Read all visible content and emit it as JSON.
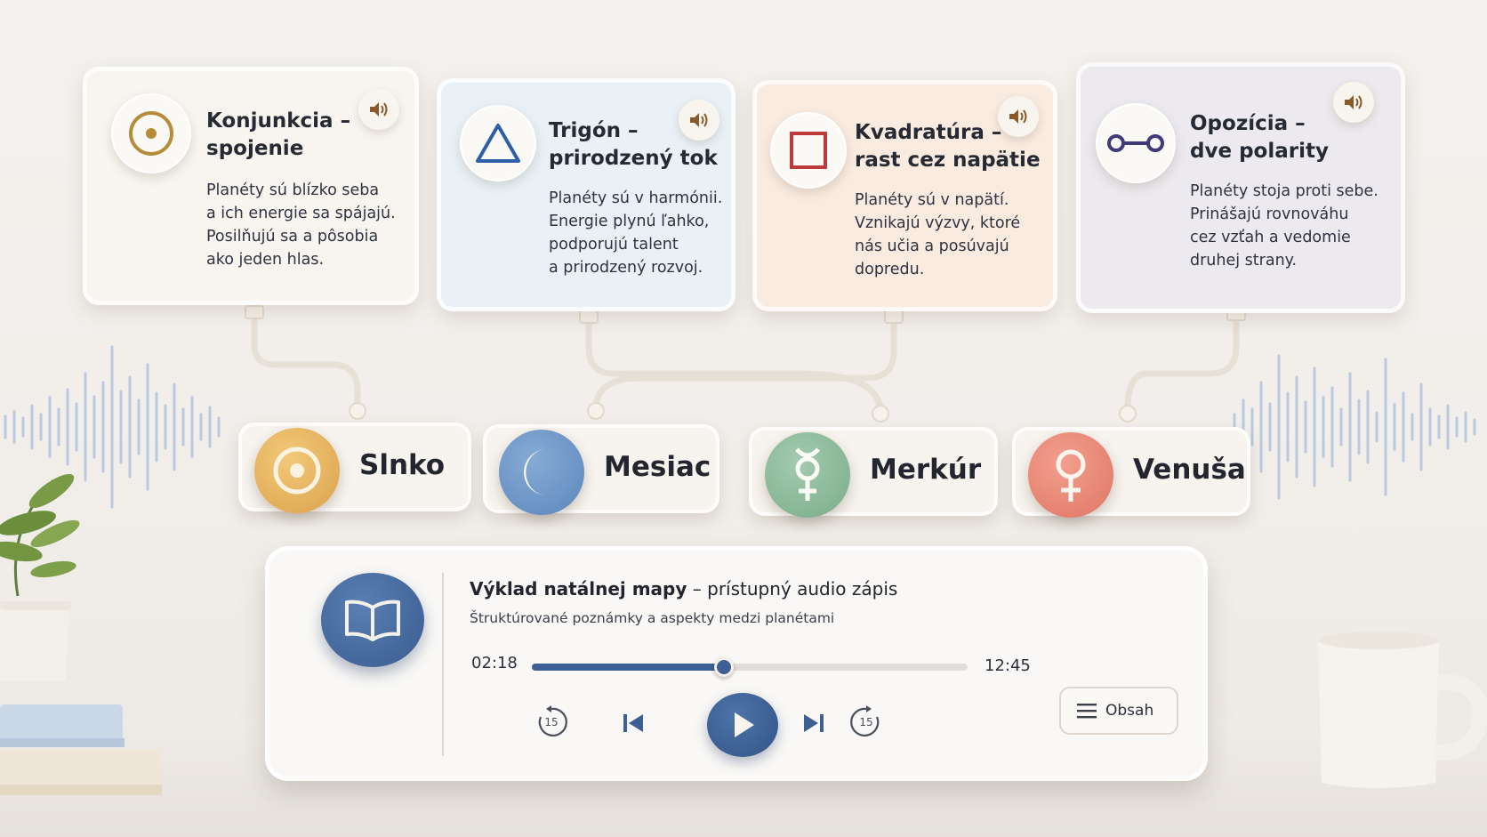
{
  "aspects": [
    {
      "title_line1": "Konjunkcia –",
      "title_line2": "spojenie",
      "desc": [
        "Planéty sú blízko seba",
        "a ich energie sa spájajú.",
        "Posilňujú sa a pôsobia",
        "ako jeden hlas."
      ],
      "icon": "conjunction-icon",
      "color": "#b58d3a"
    },
    {
      "title_line1": "Trigón –",
      "title_line2": "prirodzený tok",
      "desc": [
        "Planéty sú v harmónii.",
        "Energie plynú ľahko,",
        "podporujú talent",
        "a prirodzený rozvoj."
      ],
      "icon": "trine-icon",
      "color": "#2d5fa8"
    },
    {
      "title_line1": "Kvadratúra –",
      "title_line2": "rast cez napätie",
      "desc": [
        "Planéty sú v napätí.",
        "Vznikajú výzvy, ktoré",
        "nás učia a posúvajú",
        "dopredu."
      ],
      "icon": "square-icon",
      "color": "#c0393b"
    },
    {
      "title_line1": "Opozícia –",
      "title_line2": "dve polarity",
      "desc": [
        "Planéty stoja proti sebe.",
        "Prinášajú rovnováhu",
        "cez vzťah a vedomie",
        "druhej strany."
      ],
      "icon": "opposition-icon",
      "color": "#3f3a7a"
    }
  ],
  "planets": [
    {
      "name": "Slnko",
      "icon": "sun-icon",
      "color": "#e7b65c"
    },
    {
      "name": "Mesiac",
      "icon": "moon-icon",
      "color": "#6f98c9"
    },
    {
      "name": "Merkúr",
      "icon": "mercury-icon",
      "color": "#8dbb9c"
    },
    {
      "name": "Venuša",
      "icon": "venus-icon",
      "color": "#ec8a78"
    }
  ],
  "player": {
    "title_bold": "Výklad natálnej mapy",
    "title_rest": " – prístupný audio zápis",
    "subtitle": "Štruktúrované poznámky a aspekty medzi planétami",
    "current_time": "02:18",
    "total_time": "12:45",
    "progress": 0.44,
    "skip_back_seconds": "15",
    "skip_forward_seconds": "15",
    "contents_label": "Obsah",
    "accent": "#3e5f93"
  }
}
